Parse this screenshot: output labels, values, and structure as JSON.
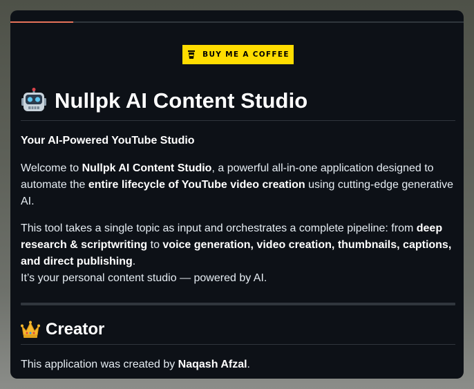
{
  "tabs": {
    "active_color": "#e8735a"
  },
  "donate": {
    "label": "BUY ME A COFFEE",
    "icon": "coffee-cup-icon",
    "color": "#ffdd00"
  },
  "header": {
    "title": "Nullpk AI Content Studio",
    "icon": "robot-icon"
  },
  "intro": {
    "subtitle": "Your AI-Powered YouTube Studio",
    "p1": {
      "t1": "Welcome to ",
      "b1": "Nullpk AI Content Studio",
      "t2": ", a powerful all-in-one application designed to automate the ",
      "b2": "entire lifecycle of YouTube video creation",
      "t3": " using cutting-edge generative AI."
    },
    "p2": {
      "t1": "This tool takes a single topic as input and orchestrates a complete pipeline: from ",
      "b1": "deep research & scriptwriting",
      "t2": " to ",
      "b2": "voice generation, video creation, thumbnails, captions, and direct publishing",
      "t3": ".",
      "line2": "It’s your personal content studio — powered by AI."
    }
  },
  "creator": {
    "heading": "Creator",
    "icon": "crown-icon",
    "t1": "This application was created by ",
    "name": "Naqash Afzal",
    "t2": "."
  }
}
